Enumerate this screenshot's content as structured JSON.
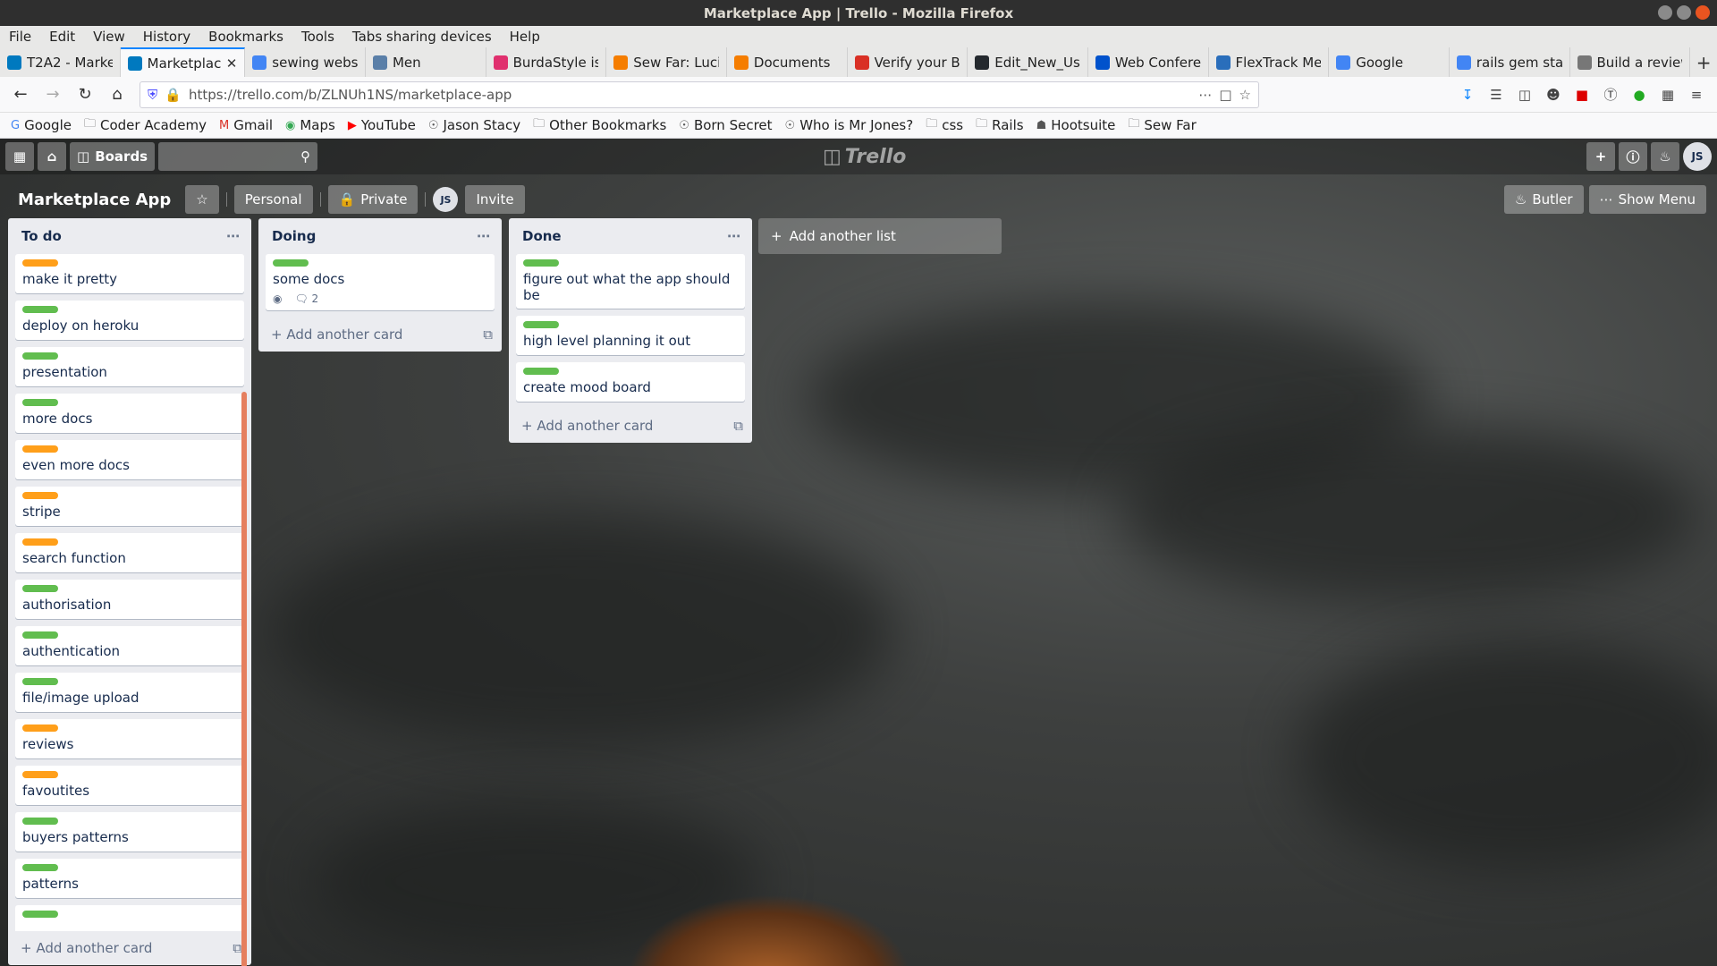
{
  "window": {
    "title": "Marketplace App | Trello - Mozilla Firefox"
  },
  "menu": [
    "File",
    "Edit",
    "View",
    "History",
    "Bookmarks",
    "Tools",
    "Tabs sharing devices",
    "Help"
  ],
  "tabs": [
    {
      "label": "T2A2 - Marke",
      "icon": "trello-icon",
      "color": "#0079bf"
    },
    {
      "label": "Marketplac",
      "icon": "trello-board-icon",
      "color": "#0079bf",
      "active": true
    },
    {
      "label": "sewing websi",
      "icon": "google-icon",
      "color": "#4285f4"
    },
    {
      "label": "Men",
      "icon": "s-icon",
      "color": "#5a7fa8"
    },
    {
      "label": "BurdaStyle is",
      "icon": "burda-icon",
      "color": "#e0306e"
    },
    {
      "label": "Sew Far: Lucic",
      "icon": "blogger-icon",
      "color": "#f57d00"
    },
    {
      "label": "Documents",
      "icon": "blogger-icon",
      "color": "#f57d00"
    },
    {
      "label": "Verify your Ba",
      "icon": "gmail-icon",
      "color": "#d93025"
    },
    {
      "label": "Edit_New_Use",
      "icon": "github-icon",
      "color": "#24292e"
    },
    {
      "label": "Web Conferen",
      "icon": "atlassian-icon",
      "color": "#0052cc"
    },
    {
      "label": "FlexTrack Mel",
      "icon": "flextrack-icon",
      "color": "#2a6ebb"
    },
    {
      "label": "Google",
      "icon": "google-icon",
      "color": "#4285f4"
    },
    {
      "label": "rails gem star",
      "icon": "google-icon",
      "color": "#4285f4"
    },
    {
      "label": "Build a review",
      "icon": "bookmark-icon",
      "color": "#777"
    }
  ],
  "nav": {
    "url": "https://trello.com/b/ZLNUh1NS/marketplace-app"
  },
  "bookmarks": [
    {
      "label": "Google",
      "icon": "google-icon"
    },
    {
      "label": "Coder Academy",
      "icon": "folder-icon"
    },
    {
      "label": "Gmail",
      "icon": "gmail-icon"
    },
    {
      "label": "Maps",
      "icon": "maps-icon"
    },
    {
      "label": "YouTube",
      "icon": "youtube-icon"
    },
    {
      "label": "Jason Stacy",
      "icon": "site-icon"
    },
    {
      "label": "Other Bookmarks",
      "icon": "folder-icon"
    },
    {
      "label": "Born Secret",
      "icon": "site-icon"
    },
    {
      "label": "Who is Mr Jones?",
      "icon": "site-icon"
    },
    {
      "label": "css",
      "icon": "folder-icon"
    },
    {
      "label": "Rails",
      "icon": "folder-icon"
    },
    {
      "label": "Hootsuite",
      "icon": "hootsuite-icon"
    },
    {
      "label": "Sew Far",
      "icon": "folder-icon"
    }
  ],
  "trello": {
    "boards_label": "Boards",
    "logo": "Trello",
    "user_initials": "JS",
    "board": {
      "title": "Marketplace App",
      "personal": "Personal",
      "private": "Private",
      "invite": "Invite",
      "butler": "Butler",
      "show_menu": "Show Menu"
    },
    "add_card": "Add another card",
    "add_list": "Add another list",
    "colors": {
      "green": "#61bd4f",
      "orange": "#ff9f1a"
    },
    "lists": [
      {
        "title": "To do",
        "cards": [
          {
            "text": "make it pretty",
            "label": "orange"
          },
          {
            "text": "deploy on heroku",
            "label": "green"
          },
          {
            "text": "presentation",
            "label": "green"
          },
          {
            "text": "more docs",
            "label": "green"
          },
          {
            "text": "even more docs",
            "label": "orange"
          },
          {
            "text": "stripe",
            "label": "orange"
          },
          {
            "text": "search function",
            "label": "orange"
          },
          {
            "text": "authorisation",
            "label": "green"
          },
          {
            "text": "authentication",
            "label": "green"
          },
          {
            "text": "file/image upload",
            "label": "green"
          },
          {
            "text": "reviews",
            "label": "orange"
          },
          {
            "text": "favoutites",
            "label": "orange"
          },
          {
            "text": "buyers patterns",
            "label": "green"
          },
          {
            "text": "patterns",
            "label": "green"
          }
        ]
      },
      {
        "title": "Doing",
        "cards": [
          {
            "text": "some docs",
            "label": "green",
            "comments": "2",
            "watching": true
          }
        ]
      },
      {
        "title": "Done",
        "cards": [
          {
            "text": "figure out what the app should be",
            "label": "green"
          },
          {
            "text": "high level planning it out",
            "label": "green"
          },
          {
            "text": "create mood board",
            "label": "green"
          }
        ]
      }
    ]
  }
}
